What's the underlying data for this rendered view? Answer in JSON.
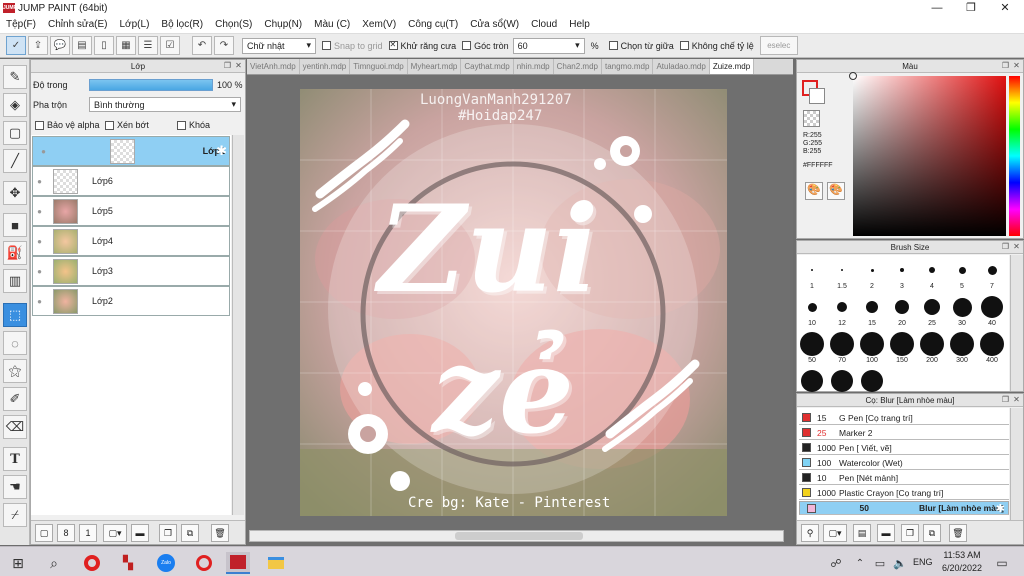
{
  "window": {
    "title": "JUMP PAINT (64bit)",
    "logo_text": "JUMP",
    "min": "—",
    "max": "❐",
    "close": "✕"
  },
  "menu": [
    "Tệp(F)",
    "Chỉnh sửa(E)",
    "Lớp(L)",
    "Bộ lọc(R)",
    "Chọn(S)",
    "Chụp(N)",
    "Màu (C)",
    "Xem(V)",
    "Công cụ(T)",
    "Cửa sổ(W)",
    "Cloud",
    "Help"
  ],
  "toolbar": {
    "shape_select": "Chữ nhật",
    "snap_label": "Snap to grid",
    "antialias_label": "Khử răng cưa",
    "round_corner_label": "Góc tròn",
    "round_corner_value": "60",
    "unit": "%",
    "center_label": "Chọn từ giữa",
    "no_ratio_label": "Không chế tỷ lệ",
    "deselect_label": "eselec"
  },
  "layer_panel": {
    "title": "Lớp",
    "opacity_label": "Độ trong",
    "opacity_value": "100 %",
    "opacity_level": 1.0,
    "blend_label": "Pha trộn",
    "blend_value": "Bình thường",
    "protect_alpha": "Bảo vệ alpha",
    "clip": "Xén bớt",
    "lock": "Khóa",
    "layers": [
      {
        "name": "Lớp1",
        "selected": true
      },
      {
        "name": "Lớp6",
        "selected": false
      },
      {
        "name": "Lớp5",
        "selected": false
      },
      {
        "name": "Lớp4",
        "selected": false
      },
      {
        "name": "Lớp3",
        "selected": false
      },
      {
        "name": "Lớp2",
        "selected": false
      }
    ]
  },
  "doc_tabs": [
    "VietAnh.mdp",
    "yentinh.mdp",
    "Timnguoi.mdp",
    "Myheart.mdp",
    "Caythat.mdp",
    "nhin.mdp",
    "Chan2.mdp",
    "tangmo.mdp",
    "Atuladao.mdp",
    "Zuize.mdp"
  ],
  "canvas": {
    "watermark1": "LuongVanManh291207",
    "watermark2": "#Hoidap247",
    "word1": "Zui",
    "word2": "zẻ",
    "credit": "Cre bg: Kate - Pinterest"
  },
  "color_panel": {
    "title": "Màu",
    "r": "R:255",
    "g": "G:255",
    "b": "B:255",
    "hex": "#FFFFFF",
    "fg_color": "#ffffff",
    "bg_color": "#ffffff"
  },
  "brush_panel": {
    "title": "Brush Size",
    "sizes": [
      "1",
      "1.5",
      "2",
      "3",
      "4",
      "5",
      "7",
      "10",
      "12",
      "15",
      "20",
      "25",
      "30",
      "40",
      "50",
      "70",
      "100",
      "150",
      "200",
      "300",
      "400"
    ]
  },
  "pen_panel": {
    "title": "Cọ: Blur [Làm nhòe màu]",
    "items": [
      {
        "size": "15",
        "name": "G Pen [Cọ trang trí]",
        "color": "#e03030",
        "selected": false
      },
      {
        "size": "25",
        "name": "Marker 2",
        "color": "#e03030",
        "selected": false
      },
      {
        "size": "1000",
        "name": "Pen [ Viết, vẽ]",
        "color": "#222222",
        "selected": false
      },
      {
        "size": "100",
        "name": "Watercolor (Wet)",
        "color": "#7fd3f5",
        "selected": false
      },
      {
        "size": "10",
        "name": "Pen [Nét mảnh]",
        "color": "#222222",
        "selected": false
      },
      {
        "size": "1000",
        "name": "Plastic Crayon [Cọ trang trí]",
        "color": "#f2d21c",
        "selected": false
      },
      {
        "size": "50",
        "name": "Blur [Làm nhòe màu]",
        "color": "#f3b6d8",
        "selected": true
      }
    ]
  },
  "taskbar": {
    "time": "11:53 AM",
    "date": "6/20/2022",
    "lang": "ENG"
  }
}
